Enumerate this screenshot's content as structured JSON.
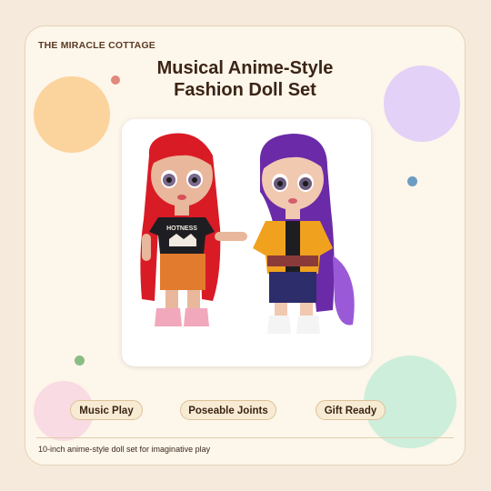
{
  "brand": "THE MIRACLE COTTAGE",
  "title_line1": "Musical Anime-Style",
  "title_line2": "Fashion Doll Set",
  "doll_left_shirt_text": "HOTNESS",
  "features": [
    "Music Play",
    "Poseable Joints",
    "Gift Ready"
  ],
  "caption": "10-inch anime-style doll set for imaginative play",
  "colors": {
    "background": "#f6eadc",
    "card": "#fdf6ea",
    "text_dark": "#3b2416",
    "pill_bg": "#f8ebd3",
    "pill_border": "#dcc29a"
  }
}
